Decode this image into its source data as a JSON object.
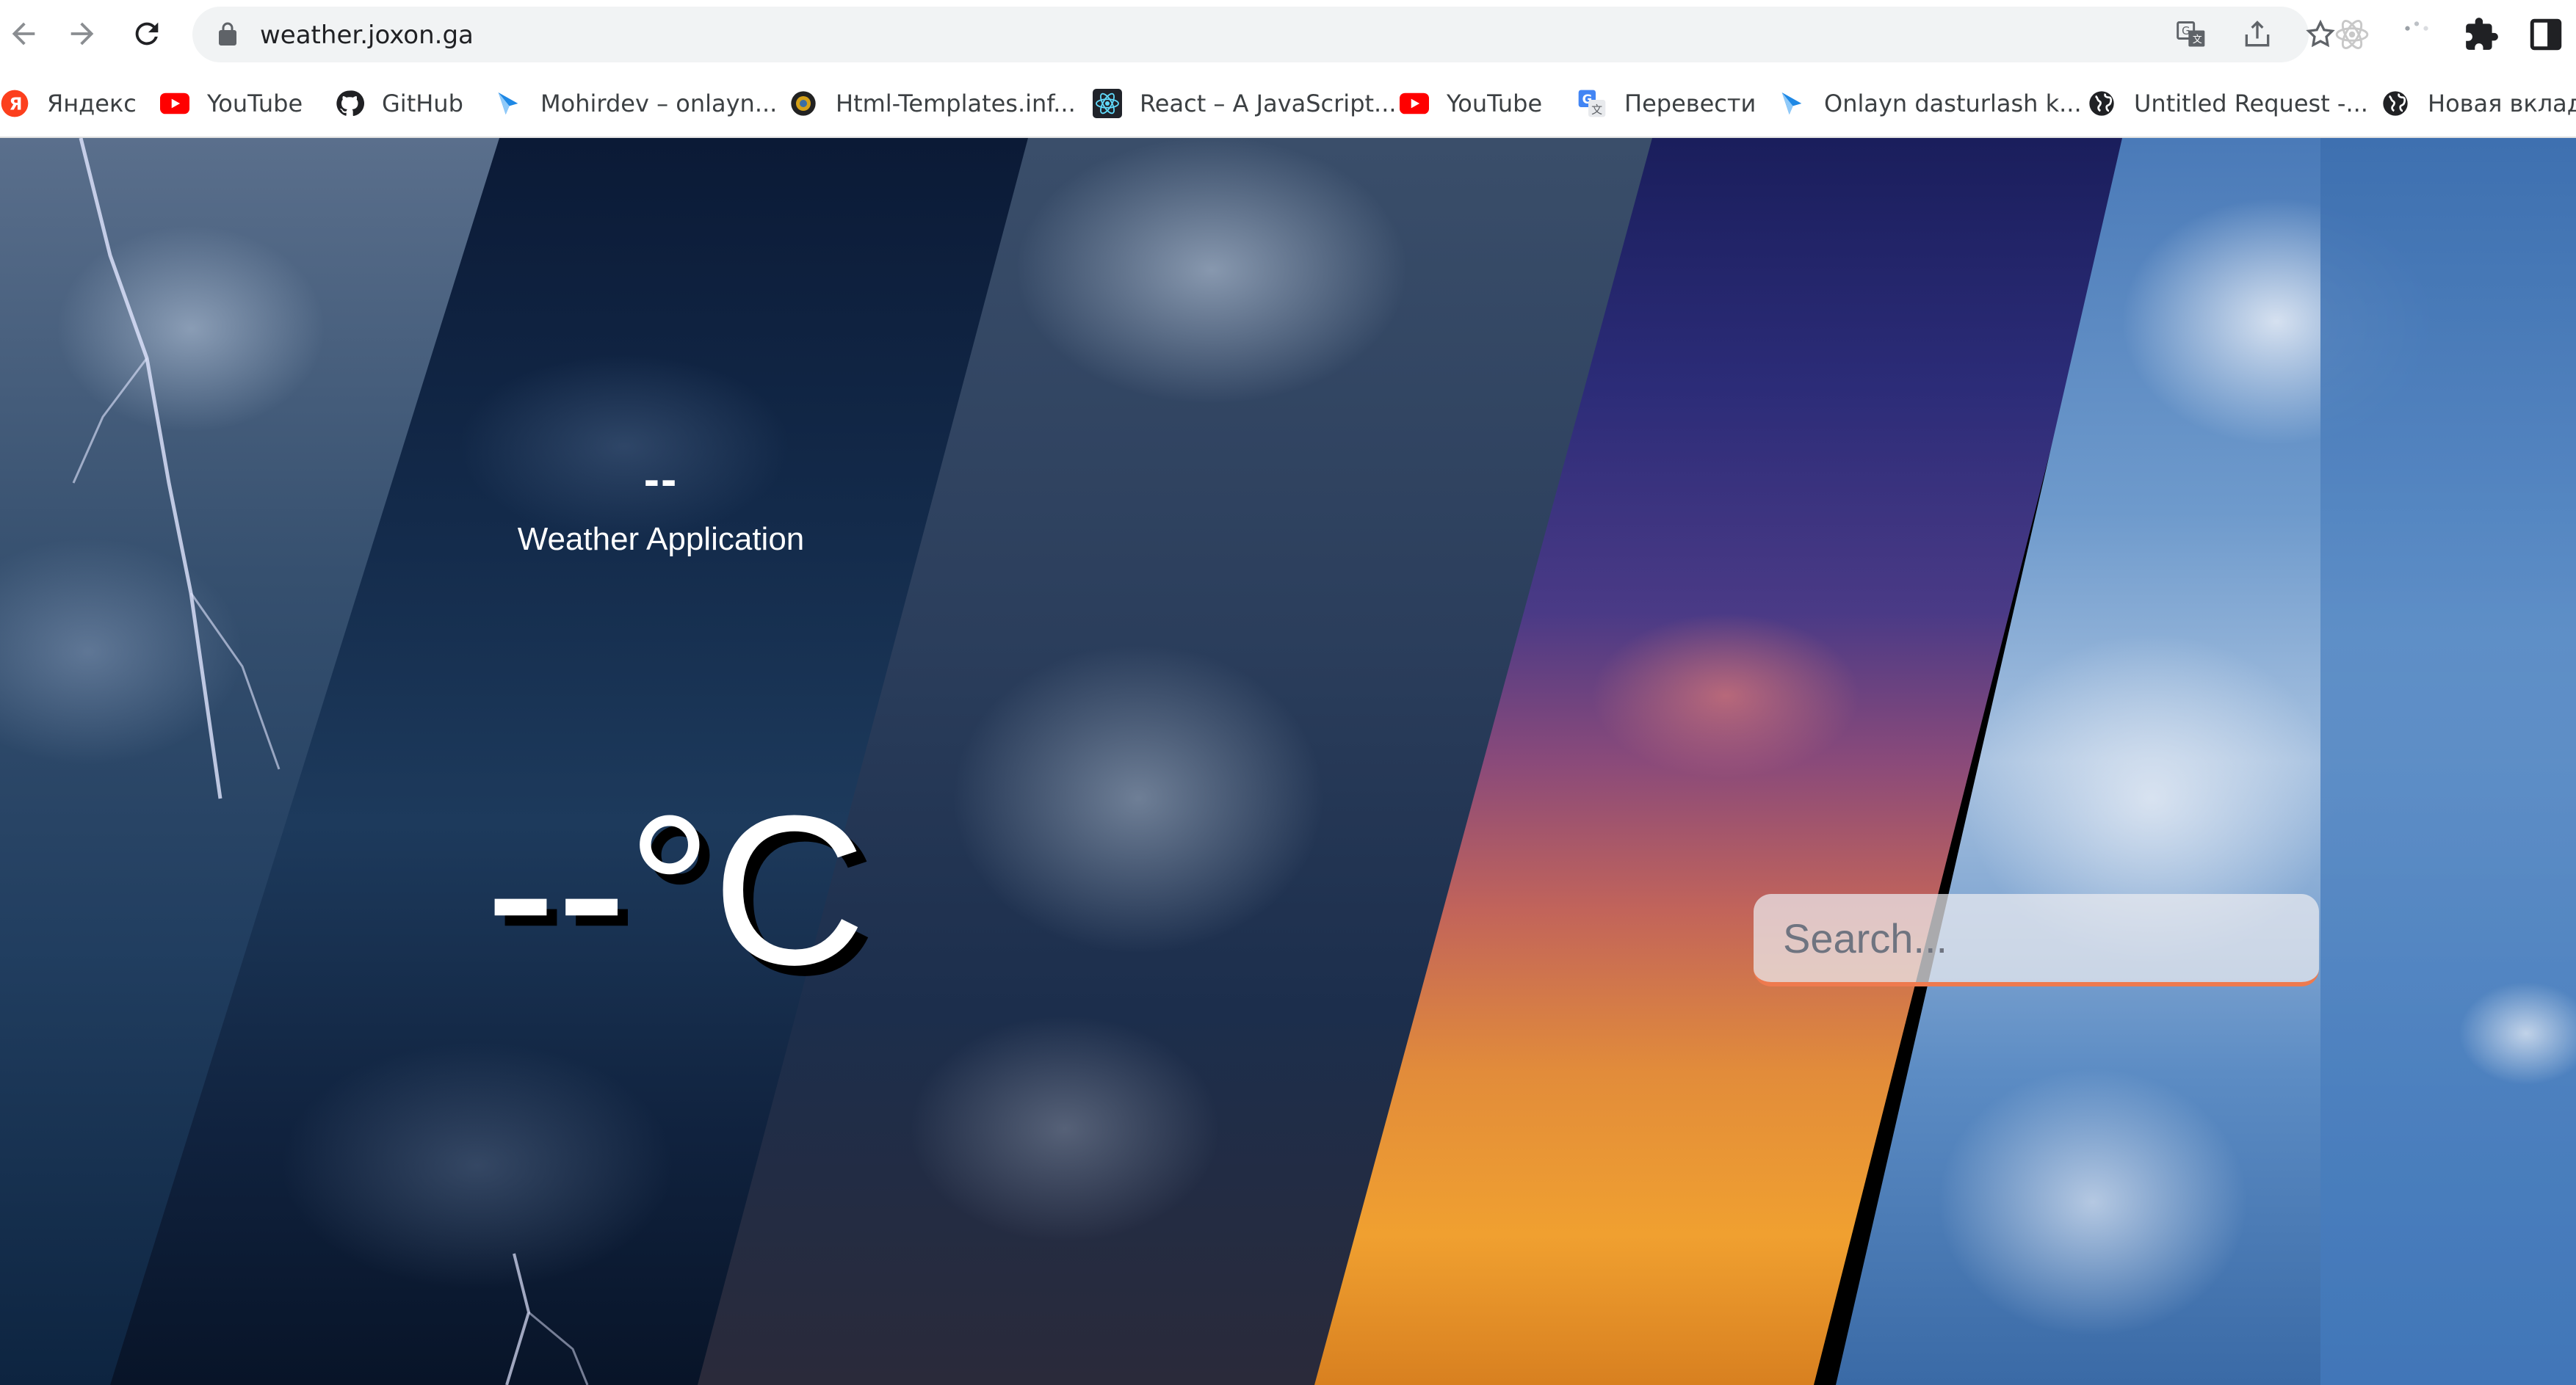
{
  "browser": {
    "url": "weather.joxon.ga",
    "bookmarks": [
      {
        "label": "Яндекс",
        "icon": "yandex-icon"
      },
      {
        "label": "YouTube",
        "icon": "youtube-icon"
      },
      {
        "label": "GitHub",
        "icon": "github-icon"
      },
      {
        "label": "Mohirdev – onlayn...",
        "icon": "mohirdev-icon"
      },
      {
        "label": "Html-Templates.inf...",
        "icon": "html-templates-icon"
      },
      {
        "label": "React – A JavaScript...",
        "icon": "react-icon"
      },
      {
        "label": "YouTube",
        "icon": "youtube-icon"
      },
      {
        "label": "Перевести",
        "icon": "translate-icon"
      },
      {
        "label": "Onlayn dasturlash k...",
        "icon": "mohirdev-icon"
      },
      {
        "label": "Untitled Request -...",
        "icon": "globe-icon"
      },
      {
        "label": "Новая вкладк",
        "icon": "globe-icon"
      }
    ]
  },
  "weather": {
    "city": "--",
    "title": "Weather Application",
    "temperature": "--°C"
  },
  "search": {
    "placeholder": "Search...",
    "accent_color": "#ee7a4e"
  }
}
